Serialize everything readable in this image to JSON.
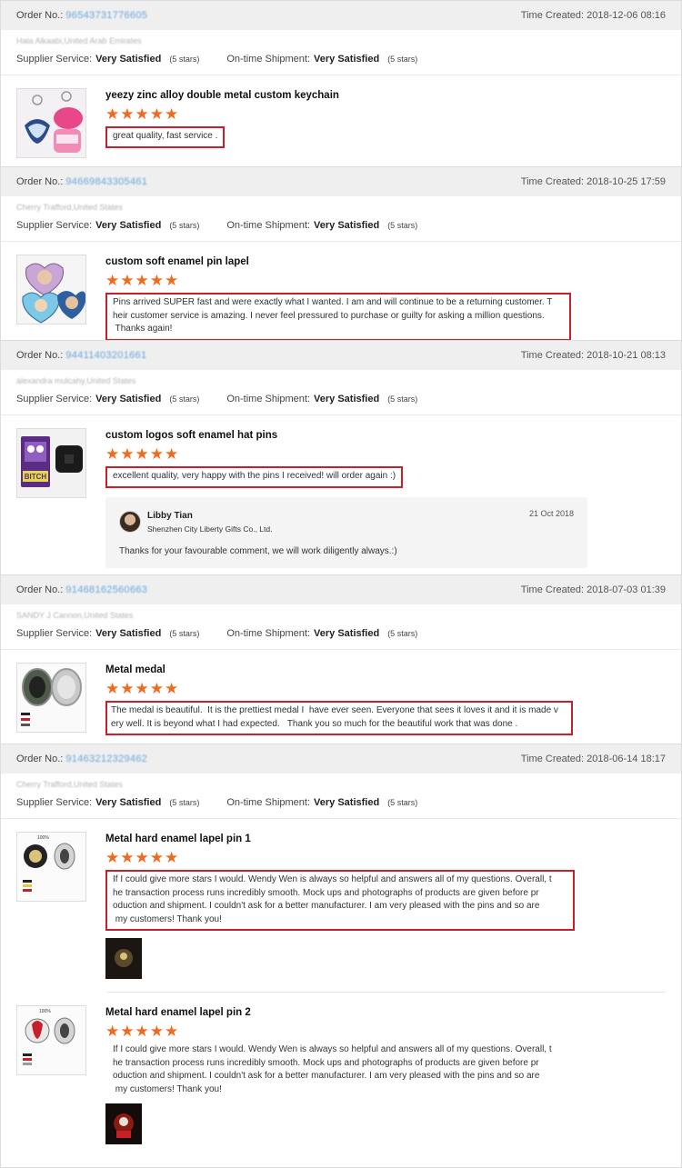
{
  "labels": {
    "order_no": "Order No.:",
    "time_created": "Time Created:",
    "supplier_service": "Supplier Service:",
    "ontime_shipment": "On-time Shipment:",
    "stars_note": "(5 stars)"
  },
  "orders": [
    {
      "order_no": "96543731776605",
      "time": "2018-12-06 08:16",
      "buyer": "Hala Alkaabi,United Arab Emirates",
      "supplier_rating": "Very Satisfied",
      "shipment_rating": "Very Satisfied",
      "products": [
        {
          "title": "yeezy zinc alloy double metal custom keychain",
          "stars": "★★★★★",
          "review": "great quality, fast service ."
        }
      ]
    },
    {
      "order_no": "94669843305461",
      "time": "2018-10-25 17:59",
      "buyer": "Cherry Trafford,United States",
      "supplier_rating": "Very Satisfied",
      "shipment_rating": "Very Satisfied",
      "products": [
        {
          "title": "custom soft enamel pin lapel",
          "stars": "★★★★★",
          "review_lines": [
            "Pins arrived SUPER fast and were exactly what I wanted. I am and will continue to be a returning customer. T",
            "heir customer service is amazing. I never feel pressured to purchase or guilty for asking a million questions.",
            " Thanks again!"
          ]
        }
      ]
    },
    {
      "order_no": "94411403201661",
      "time": "2018-10-21 08:13",
      "buyer": "alexandra mulcahy,United States",
      "supplier_rating": "Very Satisfied",
      "shipment_rating": "Very Satisfied",
      "products": [
        {
          "title": "custom logos soft enamel hat pins",
          "stars": "★★★★★",
          "review": "excellent quality, very happy with the pins I received! will order again :)"
        }
      ],
      "reply": {
        "name": "Libby Tian",
        "company": "Shenzhen City Liberty Gifts Co., Ltd.",
        "date": "21 Oct 2018",
        "text": "Thanks for your favourable comment, we will work diligently always.:)"
      }
    },
    {
      "order_no": "91468162560663",
      "time": "2018-07-03 01:39",
      "buyer": "SANDY J Cannon,United States",
      "supplier_rating": "Very Satisfied",
      "shipment_rating": "Very Satisfied",
      "products": [
        {
          "title": "Metal medal",
          "stars": "★★★★★",
          "review_lines": [
            "The medal is beautiful.  It is the prettiest medal I  have ever seen. Everyone that sees it loves it and it is made v",
            "ery well. It is beyond what I had expected.   Thank you so much for the beautiful work that was done ."
          ]
        }
      ]
    },
    {
      "order_no": "91463212329462",
      "time": "2018-06-14 18:17",
      "buyer": "Cherry Trafford,United States",
      "supplier_rating": "Very Satisfied",
      "shipment_rating": "Very Satisfied",
      "products": [
        {
          "title": "Metal hard enamel lapel pin 1",
          "stars": "★★★★★",
          "review_lines": [
            "If I could give more stars I would. Wendy Wen is always so helpful and answers all of my questions. Overall, t",
            "he transaction process runs incredibly smooth. Mock ups and photographs of products are given before pr",
            "oduction and shipment. I couldn't ask for a better manufacturer. I am very pleased with the pins and so are",
            " my customers! Thank you!"
          ]
        },
        {
          "title": "Metal hard enamel lapel pin 2",
          "stars": "★★★★★",
          "review_lines": [
            "If I could give more stars I would. Wendy Wen is always so helpful and answers all of my questions. Overall, t",
            "he transaction process runs incredibly smooth. Mock ups and photographs of products are given before pr",
            "oduction and shipment. I couldn't ask for a better manufacturer. I am very pleased with the pins and so are",
            " my customers! Thank you!"
          ]
        }
      ]
    }
  ],
  "thumb_labels": {
    "bitch_pin": "BITCH",
    "percent": "100%"
  },
  "colors": {
    "star": "#f26a1b",
    "highlight_box": "#c8202a",
    "order_link": "#6aa7e0",
    "header_bg": "#efefef"
  }
}
